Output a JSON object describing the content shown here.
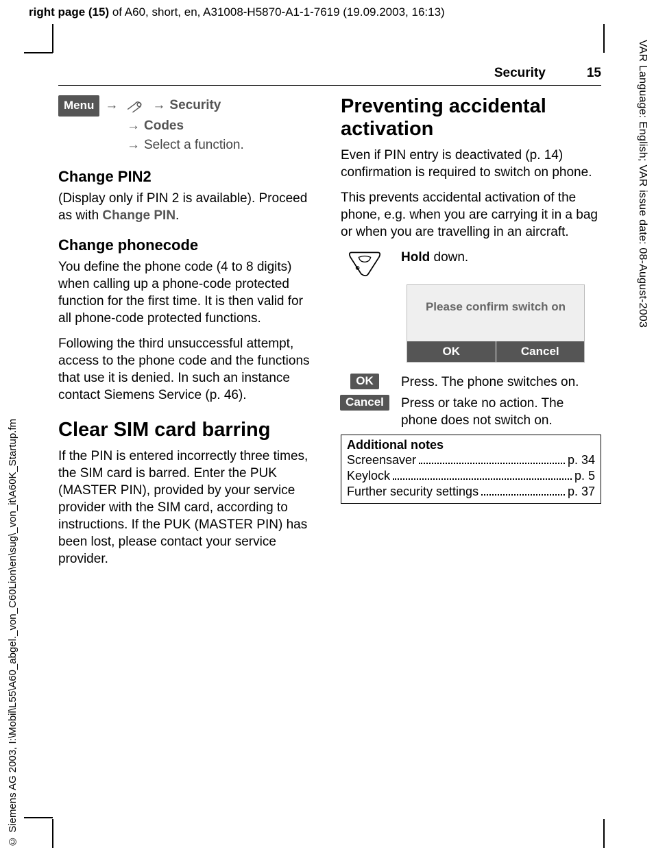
{
  "meta": {
    "top_bold": "right page (15)",
    "top_rest": " of A60, short, en, A31008-H5870-A1-1-7619 (19.09.2003, 16:13)",
    "side_right": "VAR Language: English; VAR issue date: 08-August-2003",
    "side_left": "© Siemens AG 2003, I:\\Mobil\\L55\\A60_abgel._von_C60Lion\\en\\sug\\_von_it\\A60K_Startup.fm"
  },
  "header": {
    "section": "Security",
    "page_num": "15"
  },
  "left": {
    "menu_label": "Menu",
    "nav_security": "Security",
    "nav_codes": "Codes",
    "nav_select": "Select a function.",
    "h_change_pin2": "Change PIN2",
    "p_change_pin2_a": "(Display only if PIN 2 is available). Proceed as with ",
    "p_change_pin2_b": "Change PIN",
    "p_change_pin2_c": ".",
    "h_change_phonecode": "Change phonecode",
    "p_phonecode_1": "You define the phone code (4 to 8 digits) when calling up a phone-code protected function for the first time. It is then valid for all phone-code protected functions.",
    "p_phonecode_2": "Following the third unsuccessful attempt, access to the phone code and the functions that use it is denied. In such an instance contact Siemens Service (p. 46).",
    "h_clear_sim": "Clear SIM card barring",
    "p_clear_sim": "If the PIN is entered incorrectly three times, the SIM card is barred. Enter the PUK (MASTER PIN), provided by your service provider with the SIM card, according to instructions. If the PUK (MASTER PIN) has been lost, please contact your service provider."
  },
  "right": {
    "h_prevent": "Preventing accidental activation",
    "p_prevent_1": "Even if PIN entry is deactivated (p. 14) confirmation is required to switch on phone.",
    "p_prevent_2": "This prevents accidental activation of the phone, e.g. when you are carrying it in a bag or when you are travelling in an aircraft.",
    "hold_bold": "Hold",
    "hold_rest": " down.",
    "screen_msg": "Please confirm switch on",
    "screen_ok": "OK",
    "screen_cancel": "Cancel",
    "ok_badge": "OK",
    "ok_text": "Press. The phone switches on.",
    "cancel_badge": "Cancel",
    "cancel_text": "Press or take no action. The phone does not switch on.",
    "notes_header": "Additional notes",
    "notes": [
      {
        "label": "Screensaver",
        "page": "p. 34"
      },
      {
        "label": "Keylock",
        "page": "p. 5"
      },
      {
        "label": "Further security settings",
        "page": "p. 37"
      }
    ]
  }
}
